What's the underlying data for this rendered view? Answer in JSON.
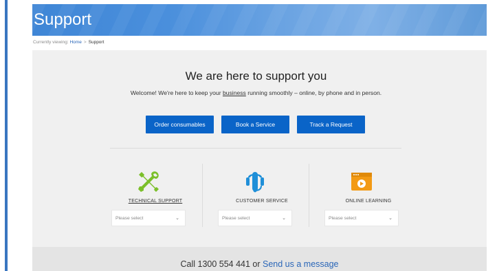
{
  "banner": {
    "title": "Support"
  },
  "breadcrumb": {
    "prefix": "Currently viewing:",
    "home": "Home",
    "separator": ">",
    "current": "Support"
  },
  "hero": {
    "headline": "We are here to support you",
    "welcome_before": "Welcome! We're here to keep your ",
    "welcome_link": "business",
    "welcome_after": " running smoothly – online, by phone and in person."
  },
  "actions": {
    "order": "Order consumables",
    "book": "Book a Service",
    "track": "Track a Request"
  },
  "columns": [
    {
      "label": "TECHNICAL SUPPORT",
      "icon": "tools-icon",
      "select_placeholder": "Please select",
      "color": "#7bbf2a"
    },
    {
      "label": "CUSTOMER SERVICE",
      "icon": "headset-icon",
      "select_placeholder": "Please select",
      "color": "#1f8fd8"
    },
    {
      "label": "ONLINE LEARNING",
      "icon": "video-player-icon",
      "select_placeholder": "Please select",
      "color": "#f39a14"
    }
  ],
  "contact": {
    "call_prefix": "Call 1300 554 441 or ",
    "message_link": "Send us a message"
  },
  "colors": {
    "accent": "#0a64c8",
    "banner": "#4a8fdc",
    "link": "#2a66b8"
  }
}
